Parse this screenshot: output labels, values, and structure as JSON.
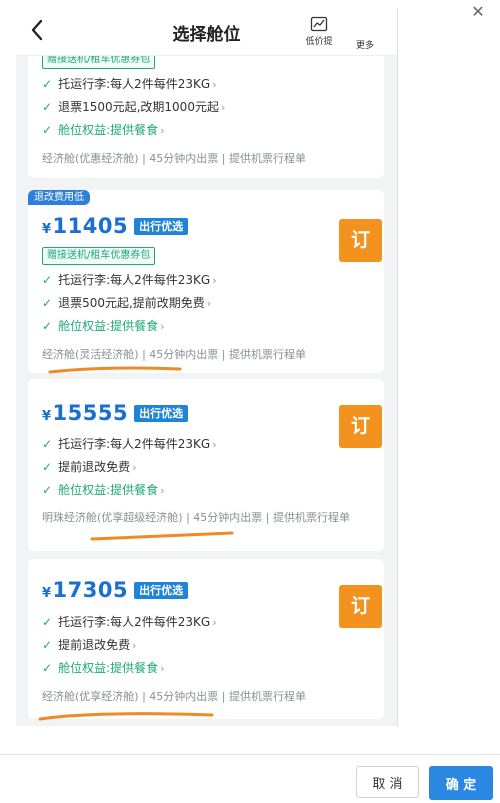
{
  "dialog": {
    "close_icon": "close-icon"
  },
  "header": {
    "title": "选择舱位",
    "low_price_label": "低价提",
    "more_label": "更多"
  },
  "cards": [
    {
      "partial_banner": "赠接送机/租车优惠券包",
      "lines": [
        {
          "text": "托运行李:每人2件每件23KG",
          "green": false
        },
        {
          "text": "退票1500元起,改期1000元起",
          "green": false
        },
        {
          "text": "舱位权益:提供餐食",
          "green": true
        }
      ],
      "footer": "经济舱(优惠经济舱) | 45分钟内出票 | 提供机票行程单"
    },
    {
      "top_badge": "退改费用低",
      "price": "11405",
      "currency": "¥",
      "pref_badge": "出行优选",
      "gift": "赠接送机/租车优惠券包",
      "lines": [
        {
          "text": "托运行李:每人2件每件23KG",
          "green": false
        },
        {
          "text": "退票500元起,提前改期免费",
          "green": false
        },
        {
          "text": "舱位权益:提供餐食",
          "green": true
        }
      ],
      "footer": "经济舱(灵活经济舱) | 45分钟内出票 | 提供机票行程单",
      "book_label": "订"
    },
    {
      "price": "15555",
      "currency": "¥",
      "pref_badge": "出行优选",
      "lines": [
        {
          "text": "托运行李:每人2件每件23KG",
          "green": false
        },
        {
          "text": "提前退改免费",
          "green": false
        },
        {
          "text": "舱位权益:提供餐食",
          "green": true
        }
      ],
      "footer": "明珠经济舱(优享超级经济舱) | 45分钟内出票 | 提供机票行程单",
      "book_label": "订"
    },
    {
      "price": "17305",
      "currency": "¥",
      "pref_badge": "出行优选",
      "lines": [
        {
          "text": "托运行李:每人2件每件23KG",
          "green": false
        },
        {
          "text": "提前退改免费",
          "green": false
        },
        {
          "text": "舱位权益:提供餐食",
          "green": true
        }
      ],
      "footer": "经济舱(优享经济舱) | 45分钟内出票 | 提供机票行程单",
      "book_label": "订"
    }
  ],
  "actions": {
    "cancel": "取 消",
    "confirm": "确 定"
  },
  "colors": {
    "price_blue": "#1a6fd1",
    "badge_blue": "#1f84d8",
    "benefit_green": "#1fa87d",
    "book_orange": "#f3921f",
    "annotation_orange": "#f08a24"
  }
}
